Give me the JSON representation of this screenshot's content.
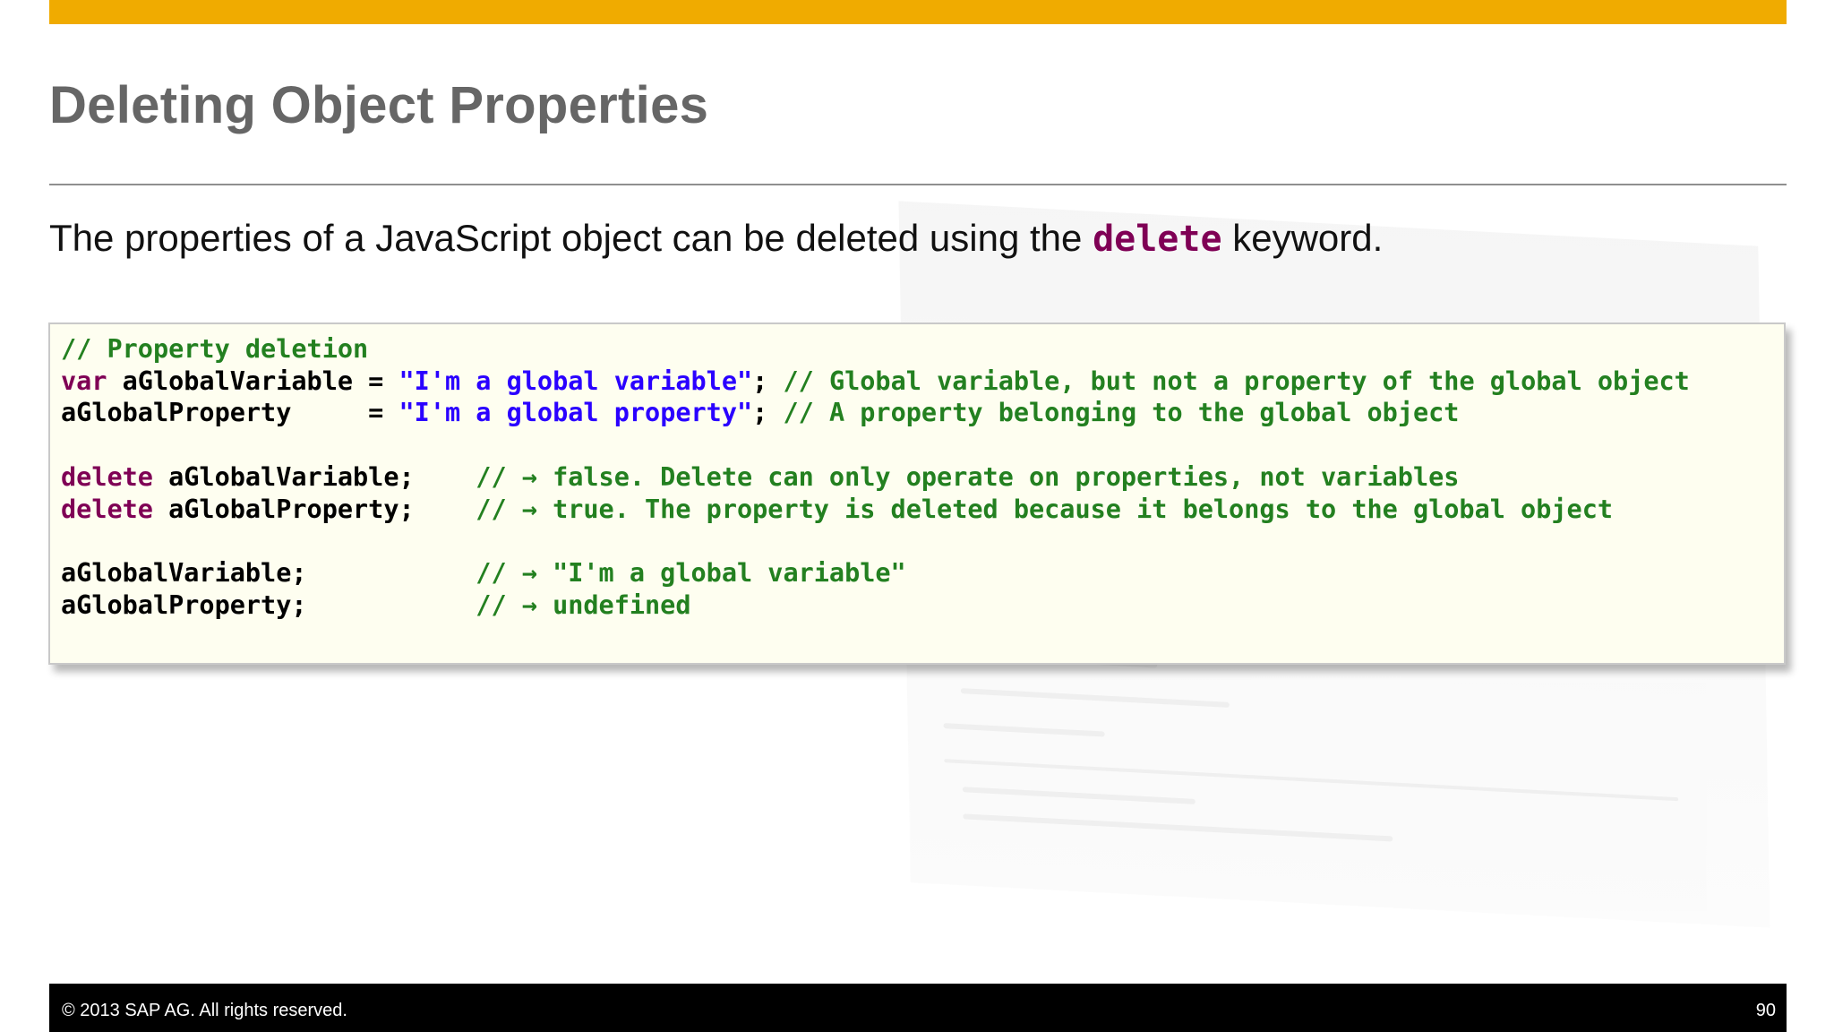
{
  "slide": {
    "title": "Deleting Object Properties",
    "intro_before": "The properties of a JavaScript object can be deleted using the ",
    "intro_keyword": "delete",
    "intro_after": " keyword."
  },
  "code": {
    "comment_title": "// Property deletion",
    "line2": {
      "kw": "var",
      "plain": " aGlobalVariable = ",
      "str": "\"I'm a global variable\"",
      "semi": "; ",
      "comment": "// Global variable, but not a property of the global object"
    },
    "line3": {
      "plain": "aGlobalProperty     = ",
      "str": "\"I'm a global property\"",
      "semi": "; ",
      "comment": "// A property belonging to the global object"
    },
    "line5": {
      "kw": "delete",
      "plain": " aGlobalVariable;    ",
      "comment": "// → false. Delete can only operate on properties, not variables"
    },
    "line6": {
      "kw": "delete",
      "plain": " aGlobalProperty;    ",
      "comment": "// → true. The property is deleted because it belongs to the global object"
    },
    "line8": {
      "plain": "aGlobalVariable;           ",
      "comment": "// → \"I'm a global variable\""
    },
    "line9": {
      "plain": "aGlobalProperty;           ",
      "comment": "// → undefined"
    }
  },
  "footer": {
    "copyright": "©  2013 SAP AG. All rights reserved.",
    "page_number": "90"
  },
  "colors": {
    "accent_bar": "#f0ab00",
    "keyword": "#7f0055",
    "string": "#2a00ff",
    "comment": "#238020"
  }
}
